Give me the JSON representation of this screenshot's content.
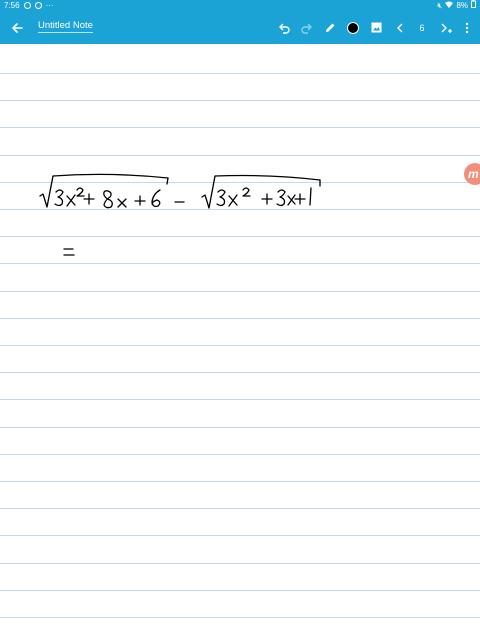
{
  "status_bar": {
    "time": "7:56",
    "battery": "8%"
  },
  "toolbar": {
    "title": "Untitled Note",
    "page_number": "6",
    "accent": "#1aa3d4",
    "icons": [
      "back-arrow-icon",
      "undo-icon",
      "redo-icon",
      "pen-icon",
      "color-swatch-icon",
      "image-icon",
      "chevron-left-icon",
      "chevron-right-plus-icon",
      "more-vertical-icon"
    ]
  },
  "note": {
    "line_color": "#bcdcec",
    "ink_color": "#000000",
    "handwriting": "√(3x² + 8x + 6) − √(3x² + 3x + 1)  =",
    "handwriting_lines": [
      "√(3x² + 8x + 6) − √(3x² + 3x + 1)",
      "="
    ]
  },
  "floating_button": {
    "label": "m",
    "color": "#f0907a"
  }
}
